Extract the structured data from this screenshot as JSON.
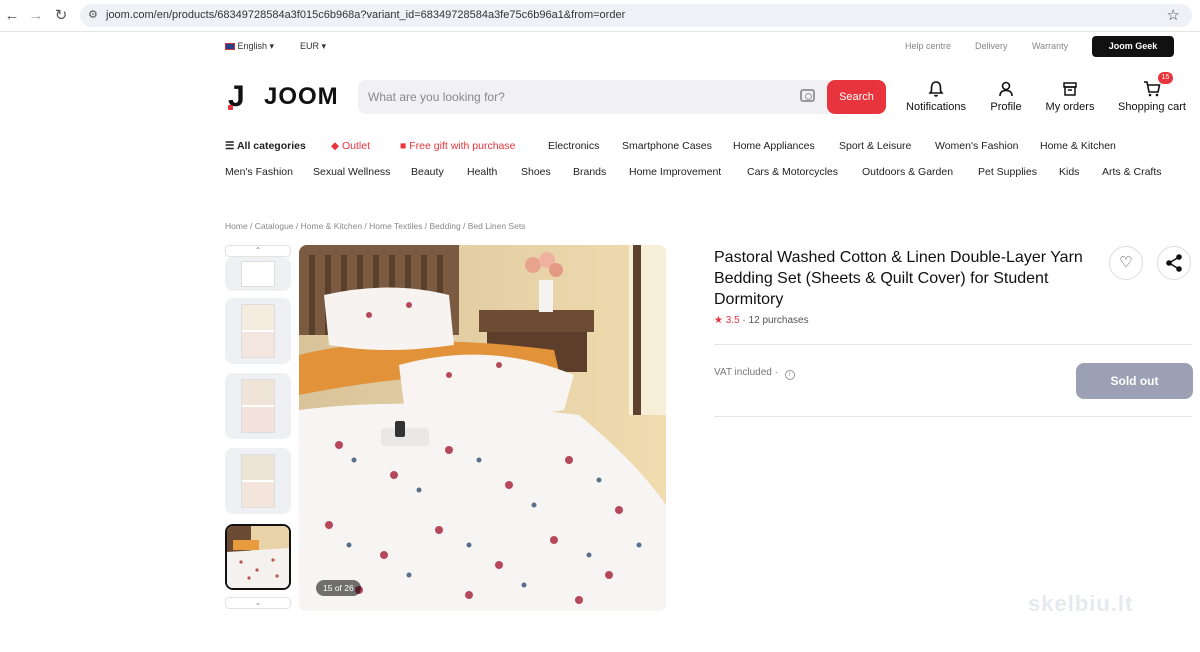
{
  "browser": {
    "url": "joom.com/en/products/68349728584a3f015c6b968a?variant_id=68349728584a3fe75c6b96a1&from=order"
  },
  "topbar": {
    "language": "English",
    "currency": "EUR",
    "links": [
      "Help centre",
      "Delivery",
      "Warranty"
    ],
    "geek_label": "Joom Geek"
  },
  "header": {
    "logo_text": "JOOM",
    "search_placeholder": "What are you looking for?",
    "search_button": "Search",
    "notifications": "Notifications",
    "profile": "Profile",
    "orders": "My orders",
    "cart": "Shopping cart",
    "cart_count": "15"
  },
  "categories_row1": [
    "All categories",
    "Outlet",
    "Free gift with purchase",
    "Electronics",
    "Smartphone Cases",
    "Home Appliances",
    "Sport & Leisure",
    "Women's Fashion",
    "Home & Kitchen"
  ],
  "categories_row2": [
    "Men's Fashion",
    "Sexual Wellness",
    "Beauty",
    "Health",
    "Shoes",
    "Brands",
    "Home Improvement",
    "Cars & Motorcycles",
    "Outdoors & Garden",
    "Pet Supplies",
    "Kids",
    "Arts & Crafts"
  ],
  "breadcrumbs": [
    "Home",
    "Catalogue",
    "Home & Kitchen",
    "Home Textiles",
    "Bedding",
    "Bed Linen Sets"
  ],
  "product": {
    "title": "Pastoral Washed Cotton & Linen Double-Layer Yarn Bedding Set (Sheets & Quilt Cover) for Student Dormitory",
    "rating": "3.5",
    "purchases": "12 purchases",
    "vat": "VAT included",
    "sold_out": "Sold out",
    "image_counter": "15 of 26"
  },
  "watermark": "skelbiu.lt",
  "colors": {
    "accent": "#e8343c",
    "sold_out": "#9ca0b5"
  }
}
